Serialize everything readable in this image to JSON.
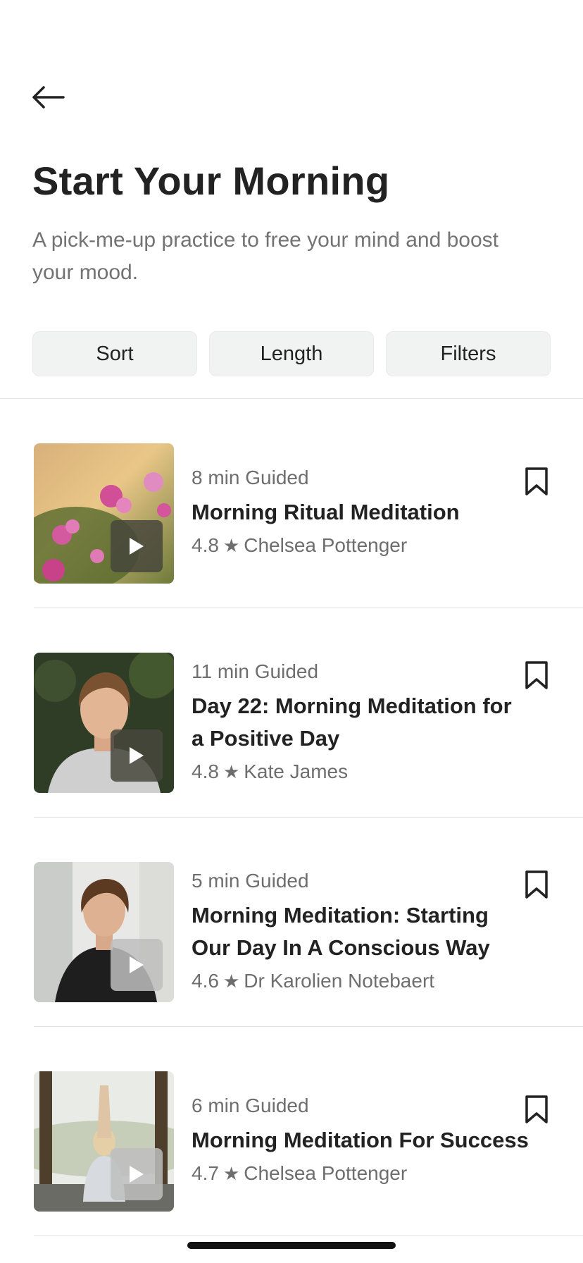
{
  "header": {
    "title": "Start Your Morning",
    "subtitle": "A pick-me-up practice to free your mind and boost your mood."
  },
  "filters": {
    "sort_label": "Sort",
    "length_label": "Length",
    "filters_label": "Filters"
  },
  "items": [
    {
      "meta": "8 min Guided",
      "title": "Morning Ritual Meditation",
      "rating": "4.8",
      "author": "Chelsea Pottenger",
      "image": "pink-flowers-photo"
    },
    {
      "meta": "11 min Guided",
      "title": "Day 22: Morning Meditation for a Positive Day",
      "rating": "4.8",
      "author": "Kate James",
      "image": "smiling-woman-portrait"
    },
    {
      "meta": "5 min Guided",
      "title": "Morning Meditation: Starting Our Day In A Conscious Way",
      "rating": "4.6",
      "author": "Dr Karolien Notebaert",
      "image": "woman-in-black-blazer-portrait"
    },
    {
      "meta": "6 min Guided",
      "title": "Morning Meditation For Success",
      "rating": "4.7",
      "author": "Chelsea Pottenger",
      "image": "woman-yoga-pose-photo"
    }
  ],
  "icons": {
    "back": "arrow-left-icon",
    "bookmark": "bookmark-icon",
    "play": "play-icon",
    "star": "star-icon"
  }
}
